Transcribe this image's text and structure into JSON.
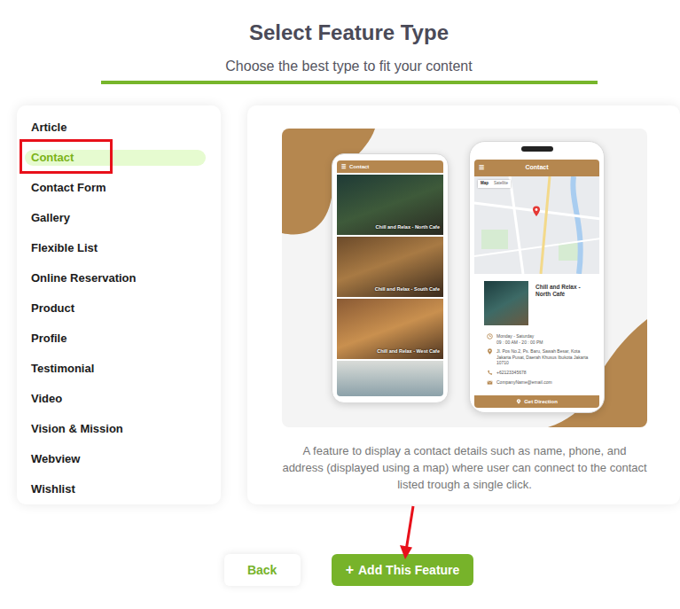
{
  "header": {
    "title": "Select Feature Type",
    "subtitle": "Choose the best type to fit your content"
  },
  "sidebar": {
    "items": [
      {
        "label": "Article",
        "selected": false,
        "highlighted": false
      },
      {
        "label": "Contact",
        "selected": true,
        "highlighted": true
      },
      {
        "label": "Contact Form",
        "selected": false,
        "highlighted": false
      },
      {
        "label": "Gallery",
        "selected": false,
        "highlighted": false
      },
      {
        "label": "Flexible List",
        "selected": false,
        "highlighted": false
      },
      {
        "label": "Online Reservation",
        "selected": false,
        "highlighted": false
      },
      {
        "label": "Product",
        "selected": false,
        "highlighted": false
      },
      {
        "label": "Profile",
        "selected": false,
        "highlighted": false
      },
      {
        "label": "Testimonial",
        "selected": false,
        "highlighted": false
      },
      {
        "label": "Video",
        "selected": false,
        "highlighted": false
      },
      {
        "label": "Vision & Mission",
        "selected": false,
        "highlighted": false
      },
      {
        "label": "Webview",
        "selected": false,
        "highlighted": false
      },
      {
        "label": "Wishlist",
        "selected": false,
        "highlighted": false
      }
    ]
  },
  "preview": {
    "phone_list": {
      "menu_icon": "☰",
      "title": "Contact",
      "items": [
        "Chill and Relax - North Cafe",
        "Chill and Relax - South Cafe",
        "Chill and Relax - West Cafe"
      ]
    },
    "phone_detail": {
      "menu_icon": "☰",
      "title": "Contact",
      "map_tabs": [
        {
          "label": "Map",
          "selected": true
        },
        {
          "label": "Satellite",
          "selected": false
        }
      ],
      "name": "Chill and Relax - North Café",
      "hours": [
        "Monday - Saturday",
        "09 : 00 AM - 20 : 00 PM"
      ],
      "address": "Jl. Pos No.2, Ps. Baru, Sawah Besar, Kota Jakarta Pusat, Daerah Khusus Ibukota Jakarta 10710",
      "phone": "+62123345678",
      "email": "CompanyName@email.com",
      "button": "Get Direction"
    },
    "description": "A feature to display a contact details such as name, phone, and address (displayed using a map) where user can connect to the contact listed trough a single click."
  },
  "buttons": [
    {
      "label": "Back",
      "kind": "secondary",
      "pointed": false
    },
    {
      "label": "Add This Feature",
      "icon": "+",
      "kind": "primary",
      "pointed": true
    }
  ]
}
